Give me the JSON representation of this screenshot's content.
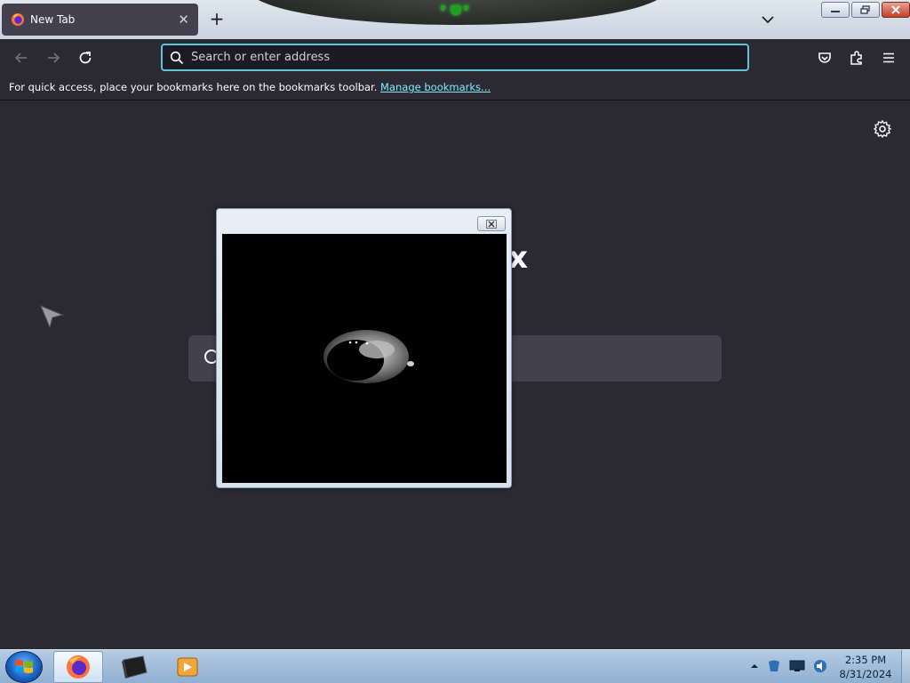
{
  "tab": {
    "title": "New Tab",
    "close": "✕"
  },
  "newtab": {
    "label": "+"
  },
  "urlbar": {
    "placeholder": "Search or enter address"
  },
  "bookmarks": {
    "message": "For quick access, place your bookmarks here on the bookmarks toolbar.",
    "link": "Manage bookmarks..."
  },
  "content": {
    "brand_partial": "fox"
  },
  "clock": {
    "time": "2:35 PM",
    "date": "8/31/2024"
  },
  "colors": {
    "accent": "#5ec5d6",
    "link": "#80ebff",
    "page_bg": "#2b2a33",
    "tab_bg": "#42414d"
  },
  "icons": {
    "back": "arrow-left-icon",
    "forward": "arrow-right-icon",
    "reload": "reload-icon",
    "search": "search-icon",
    "pocket": "pocket-icon",
    "extensions": "puzzle-icon",
    "menu": "hamburger-icon",
    "settings": "gear-icon"
  }
}
